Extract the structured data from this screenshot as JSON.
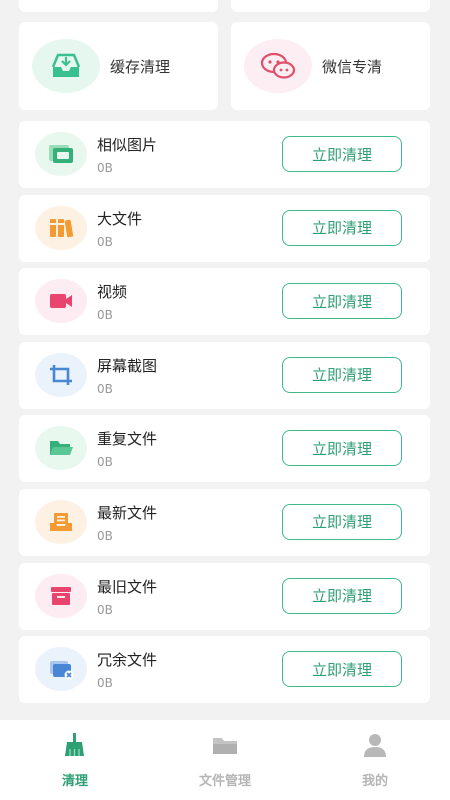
{
  "feature_cards": [
    {
      "label": "缓存清理",
      "icon": "inbox-download-icon",
      "bg": "#e6f7f0",
      "color": "#39c08f"
    },
    {
      "label": "微信专清",
      "icon": "wechat-icon",
      "bg": "#fdeef3",
      "color": "#e0506b"
    }
  ],
  "clean_button_label": "立即清理",
  "items": [
    {
      "title": "相似图片",
      "size": "0B",
      "icon": "similar-images-icon",
      "bg": "#e8f8ee",
      "color": "#36b07a"
    },
    {
      "title": "大文件",
      "size": "0B",
      "icon": "books-icon",
      "bg": "#fdf1e3",
      "color": "#f39a32"
    },
    {
      "title": "视频",
      "size": "0B",
      "icon": "video-camera-icon",
      "bg": "#fdecf1",
      "color": "#e8446d"
    },
    {
      "title": "屏幕截图",
      "size": "0B",
      "icon": "crop-icon",
      "bg": "#eaf2fb",
      "color": "#4a86d6"
    },
    {
      "title": "重复文件",
      "size": "0B",
      "icon": "folder-icon",
      "bg": "#e8f8ee",
      "color": "#36b07a"
    },
    {
      "title": "最新文件",
      "size": "0B",
      "icon": "new-file-tray-icon",
      "bg": "#fdf1e3",
      "color": "#f39a32"
    },
    {
      "title": "最旧文件",
      "size": "0B",
      "icon": "archive-box-icon",
      "bg": "#fdecf1",
      "color": "#e8446d"
    },
    {
      "title": "冗余文件",
      "size": "0B",
      "icon": "redundant-file-icon",
      "bg": "#eaf2fb",
      "color": "#4a86d6"
    }
  ],
  "tabbar": [
    {
      "label": "清理",
      "icon": "broom-icon",
      "active": true
    },
    {
      "label": "文件管理",
      "icon": "folder-icon",
      "active": false
    },
    {
      "label": "我的",
      "icon": "user-icon",
      "active": false
    }
  ],
  "colors": {
    "accent": "#2f9f74",
    "background": "#f2f2f2"
  }
}
